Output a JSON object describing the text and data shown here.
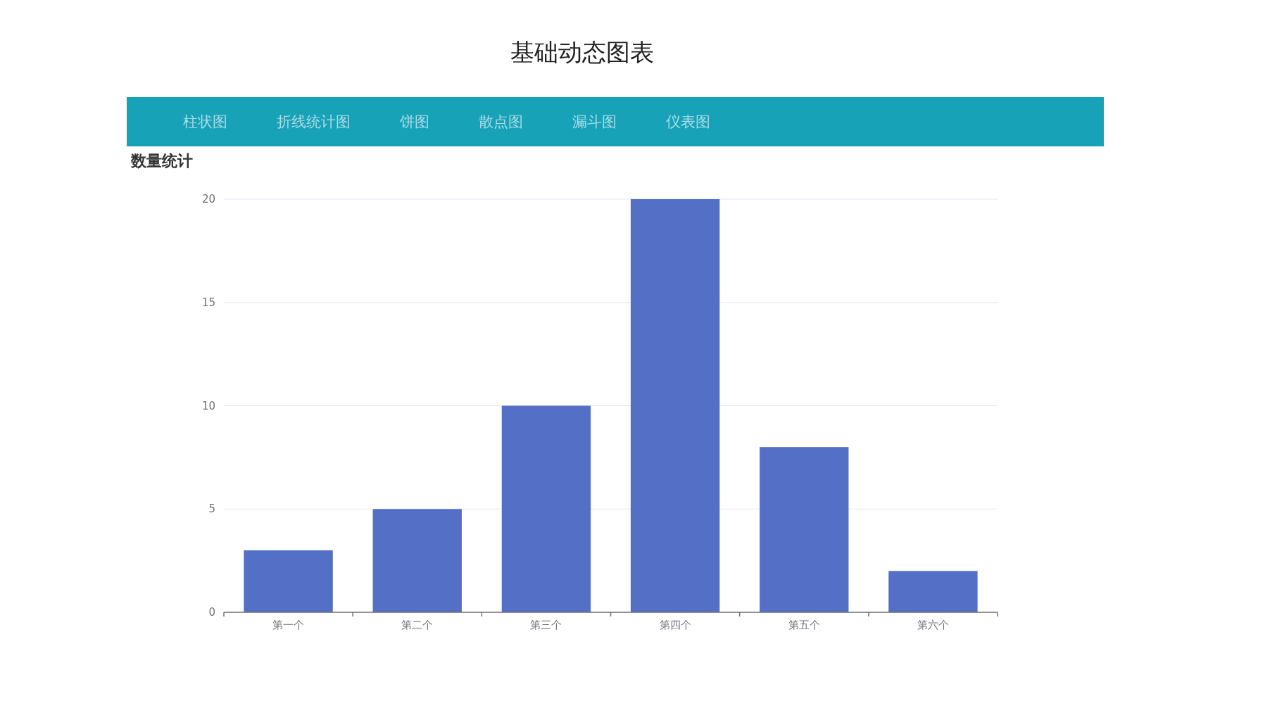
{
  "page_title": "基础动态图表",
  "nav": [
    "柱状图",
    "折线统计图",
    "饼图",
    "散点图",
    "漏斗图",
    "仪表图"
  ],
  "section_title": "数量统计",
  "chart_data": {
    "type": "bar",
    "categories": [
      "第一个",
      "第二个",
      "第三个",
      "第四个",
      "第五个",
      "第六个"
    ],
    "series": [
      {
        "color": "#5470c6",
        "values": [
          3,
          5,
          10,
          20,
          8,
          2
        ]
      }
    ],
    "ylim": [
      0,
      20
    ],
    "yticks": [
      0,
      5,
      10,
      15,
      20
    ],
    "grid": true
  }
}
